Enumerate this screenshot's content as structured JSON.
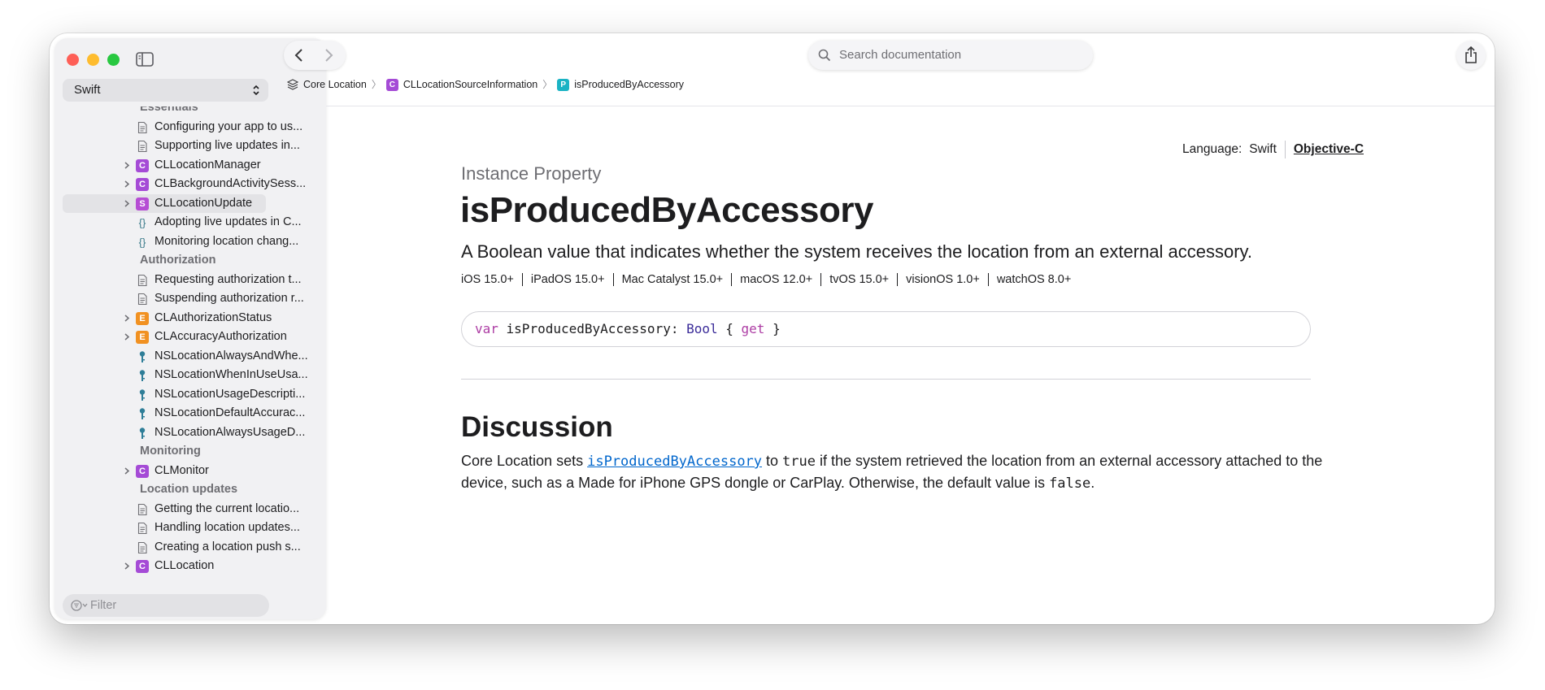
{
  "sidebar": {
    "language": "Swift",
    "filter_placeholder": "Filter",
    "items": [
      {
        "kind": "heading",
        "label": "Essentials"
      },
      {
        "kind": "doc",
        "label": "Configuring your app to us..."
      },
      {
        "kind": "doc",
        "label": "Supporting live updates in..."
      },
      {
        "kind": "badge",
        "badge": "C",
        "label": "CLLocationManager",
        "expandable": true
      },
      {
        "kind": "badge",
        "badge": "C",
        "label": "CLBackgroundActivitySess...",
        "expandable": true
      },
      {
        "kind": "badge",
        "badge": "S",
        "label": "CLLocationUpdate",
        "expandable": true,
        "selected": true
      },
      {
        "kind": "code",
        "label": "Adopting live updates in C..."
      },
      {
        "kind": "code",
        "label": "Monitoring location chang..."
      },
      {
        "kind": "heading",
        "label": "Authorization"
      },
      {
        "kind": "doc",
        "label": "Requesting authorization t..."
      },
      {
        "kind": "doc",
        "label": "Suspending authorization r..."
      },
      {
        "kind": "badge",
        "badge": "E",
        "label": "CLAuthorizationStatus",
        "expandable": true
      },
      {
        "kind": "badge",
        "badge": "E",
        "label": "CLAccuracyAuthorization",
        "expandable": true
      },
      {
        "kind": "key",
        "label": "NSLocationAlwaysAndWhe..."
      },
      {
        "kind": "key",
        "label": "NSLocationWhenInUseUsa..."
      },
      {
        "kind": "key",
        "label": "NSLocationUsageDescripti..."
      },
      {
        "kind": "key",
        "label": "NSLocationDefaultAccurac..."
      },
      {
        "kind": "key",
        "label": "NSLocationAlwaysUsageD..."
      },
      {
        "kind": "heading",
        "label": "Monitoring"
      },
      {
        "kind": "badge",
        "badge": "C",
        "label": "CLMonitor",
        "expandable": true
      },
      {
        "kind": "heading",
        "label": "Location updates"
      },
      {
        "kind": "doc",
        "label": "Getting the current locatio..."
      },
      {
        "kind": "doc",
        "label": "Handling location updates..."
      },
      {
        "kind": "doc",
        "label": "Creating a location push s..."
      },
      {
        "kind": "badge",
        "badge": "C",
        "label": "CLLocation",
        "expandable": true
      }
    ]
  },
  "toolbar": {
    "search_placeholder": "Search documentation"
  },
  "breadcrumb": [
    {
      "label": "Core Location",
      "icon": "framework-icon"
    },
    {
      "label": "CLLocationSourceInformation",
      "badge": "C"
    },
    {
      "label": "isProducedByAccessory",
      "badge": "P"
    }
  ],
  "main": {
    "language_label": "Language:",
    "language_swift": "Swift",
    "language_objc": "Objective-C",
    "kind": "Instance Property",
    "title": "isProducedByAccessory",
    "abstract": "A Boolean value that indicates whether the system receives the location from an external accessory.",
    "platforms": [
      "iOS 15.0+",
      "iPadOS 15.0+",
      "Mac Catalyst 15.0+",
      "macOS 12.0+",
      "tvOS 15.0+",
      "visionOS 1.0+",
      "watchOS 8.0+"
    ],
    "declaration": {
      "kw_var": "var",
      "name": " isProducedByAccessory: ",
      "type": "Bool",
      "brace_open": " { ",
      "kw_get": "get",
      "brace_close": " }"
    },
    "discussion_heading": "Discussion",
    "discussion": {
      "t1": "Core Location sets ",
      "link": "isProducedByAccessory",
      "t2": " to ",
      "code_true": "true",
      "t3": " if the system retrieved the location from an external accessory attached to the device, such as a Made for iPhone GPS dongle or CarPlay. Otherwise, the default value is ",
      "code_false": "false",
      "t4": "."
    }
  },
  "colors": {
    "class_badge": "#a54bd6",
    "enum_badge": "#f19121",
    "property_badge": "#1ab3c4",
    "link": "#0066cc",
    "keyword": "#ad3da4"
  }
}
